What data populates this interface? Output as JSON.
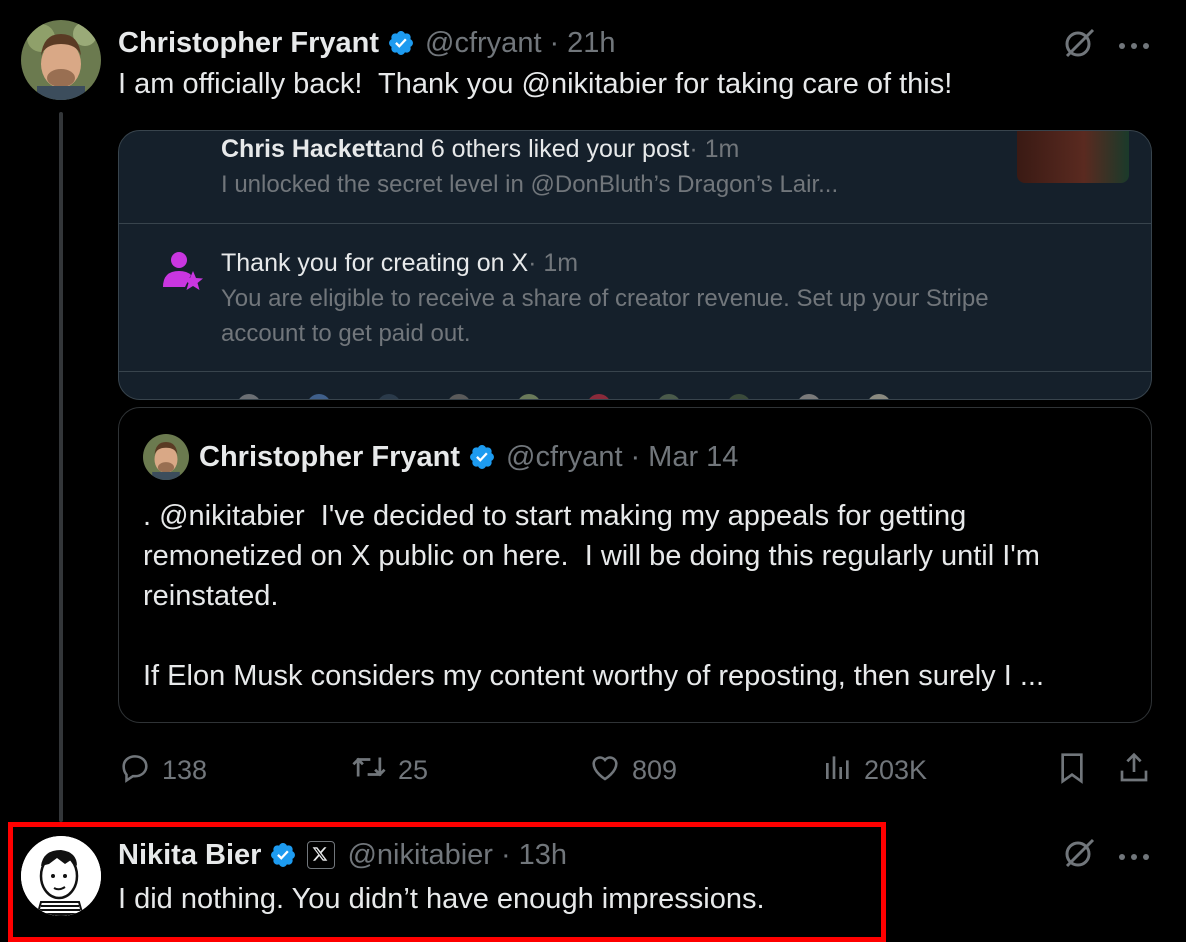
{
  "tweet": {
    "author_name": "Christopher Fryant",
    "handle": "@cfryant",
    "separator": "·",
    "time": "21h",
    "text": "I am officially back!  Thank you @nikitabier for taking care of this!"
  },
  "screenshot_card": {
    "notif1": {
      "name": "Chris Hackett",
      "action": " and 6 others liked your post",
      "time": " · 1m",
      "sub": "I unlocked the secret level in @DonBluth’s Dragon’s Lair..."
    },
    "notif2": {
      "title": "Thank you for creating on X",
      "time": " · 1m",
      "sub_line1": "You are eligible to receive a share of creator revenue. Set up your Stripe",
      "sub_line2": "account to get paid out."
    }
  },
  "quote": {
    "author_name": "Christopher Fryant",
    "handle": "@cfryant",
    "separator": "·",
    "date": "Mar 14",
    "line1": ". @nikitabier  I've decided to start making my appeals for getting",
    "line2": "remonetized on X public on here.  I will be doing this regularly until I'm",
    "line3": "reinstated.",
    "line4": "If Elon Musk considers my content worthy of reposting, then surely I ..."
  },
  "stats": {
    "replies": "138",
    "reposts": "25",
    "likes": "809",
    "views": "203K"
  },
  "reply": {
    "author_name": "Nikita Bier",
    "handle": "@nikitabier",
    "separator": "·",
    "time": "13h",
    "text": "I did nothing. You didn’t have enough impressions."
  },
  "colors": {
    "background": "#000000",
    "verified": "#1d9bf0",
    "muted": "#71767b",
    "highlight": "#ff0000",
    "card_bg": "#15202b",
    "creator_icon": "#c936e0"
  },
  "icons": [
    "verified-badge-icon",
    "grok-icon",
    "more-icon",
    "reply-icon",
    "repost-icon",
    "like-icon",
    "views-icon",
    "bookmark-icon",
    "share-icon",
    "creator-star-icon",
    "x-logo-icon"
  ]
}
